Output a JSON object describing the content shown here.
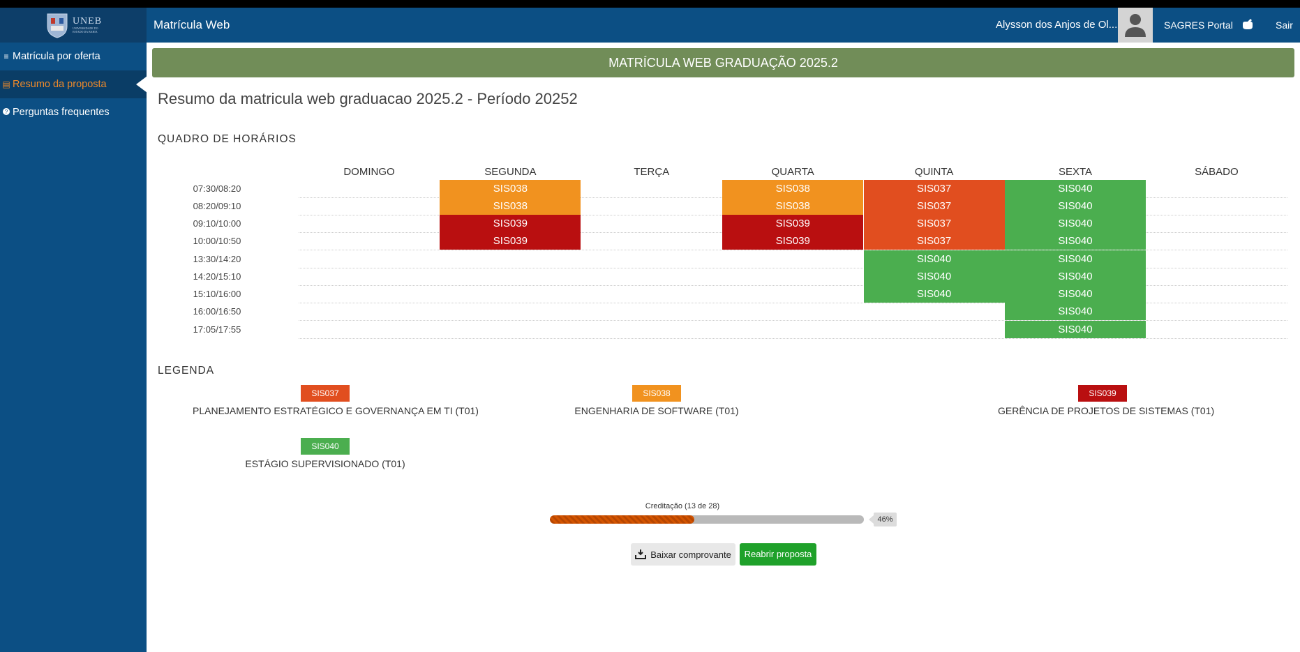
{
  "header": {
    "app_title": "Matrícula Web",
    "user_name": "Alysson dos Anjos de Ol...",
    "portal_label": "SAGRES Portal",
    "logout_label": "Sair",
    "logo_text": "UNEB",
    "logo_subtext": "UNIVERSIDADE DO ESTADO DA BAHIA"
  },
  "sidebar": {
    "items": [
      {
        "label": "Matrícula por oferta",
        "icon": "list-icon"
      },
      {
        "label": "Resumo da proposta",
        "icon": "document-icon",
        "active": true
      },
      {
        "label": "Perguntas frequentes",
        "icon": "question-circle-icon"
      }
    ]
  },
  "banner": "MATRÍCULA WEB GRADUAÇÃO 2025.2",
  "page_title": "Resumo da matricula web graduacao 2025.2 - Período 20252",
  "schedule": {
    "heading": "QUADRO DE HORÁRIOS",
    "days": [
      "DOMINGO",
      "SEGUNDA",
      "TERÇA",
      "QUARTA",
      "QUINTA",
      "SEXTA",
      "SÁBADO"
    ],
    "times": [
      "07:30/08:20",
      "08:20/09:10",
      "09:10/10:00",
      "10:00/10:50",
      "13:30/14:20",
      "14:20/15:10",
      "15:10/16:00",
      "16:00/16:50",
      "17:05/17:55"
    ],
    "grid": [
      [
        "",
        "SIS038",
        "",
        "SIS038",
        "SIS037",
        "SIS040",
        ""
      ],
      [
        "",
        "SIS038",
        "",
        "SIS038",
        "SIS037",
        "SIS040",
        ""
      ],
      [
        "",
        "SIS039",
        "",
        "SIS039",
        "SIS037",
        "SIS040",
        ""
      ],
      [
        "",
        "SIS039",
        "",
        "SIS039",
        "SIS037",
        "SIS040",
        ""
      ],
      [
        "",
        "",
        "",
        "",
        "SIS040",
        "SIS040",
        ""
      ],
      [
        "",
        "",
        "",
        "",
        "SIS040",
        "SIS040",
        ""
      ],
      [
        "",
        "",
        "",
        "",
        "SIS040",
        "SIS040",
        ""
      ],
      [
        "",
        "",
        "",
        "",
        "",
        "SIS040",
        ""
      ],
      [
        "",
        "",
        "",
        "",
        "",
        "SIS040",
        ""
      ]
    ]
  },
  "legend": {
    "heading": "LEGENDA",
    "items": [
      {
        "code": "SIS037",
        "name": "PLANEJAMENTO ESTRATÉGICO E GOVERNANÇA EM TI (T01)",
        "color": "#e14e1f"
      },
      {
        "code": "SIS038",
        "name": "ENGENHARIA DE SOFTWARE (T01)",
        "color": "#f1921f"
      },
      {
        "code": "SIS039",
        "name": "GERÊNCIA DE PROJETOS DE SISTEMAS (T01)",
        "color": "#b90f10"
      },
      {
        "code": "SIS040",
        "name": "ESTÁGIO SUPERVISIONADO (T01)",
        "color": "#4bae4f"
      }
    ]
  },
  "progress": {
    "label": "Creditação (13 de 28)",
    "percent_text": "46%",
    "fraction": 0.46
  },
  "buttons": {
    "download_label": "Baixar comprovante",
    "reopen_label": "Reabrir proposta"
  },
  "colors": {
    "header_bg": "#0c4f84",
    "banner_bg": "#718d58",
    "active_menu": "#ef8a2a",
    "reopen_button": "#1fa12a"
  }
}
